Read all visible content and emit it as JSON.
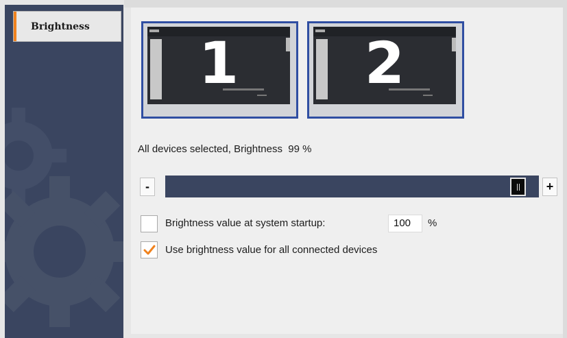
{
  "sidebar": {
    "items": [
      {
        "label": "Brightness",
        "selected": true
      }
    ],
    "accent_color": "#f0821e",
    "background_color": "#3a4560"
  },
  "devices": [
    {
      "number": "1"
    },
    {
      "number": "2"
    }
  ],
  "device_border_color": "#2f4ea2",
  "status": {
    "text": "All devices selected, Brightness",
    "value": "99 %"
  },
  "slider": {
    "decrease_label": "-",
    "increase_label": "+",
    "value_fraction": 0.99
  },
  "startup": {
    "checked": false,
    "label": "Brightness value at system startup:",
    "value": "100",
    "unit": "%"
  },
  "all_devices": {
    "checked": true,
    "label": "Use brightness value for all connected devices"
  }
}
